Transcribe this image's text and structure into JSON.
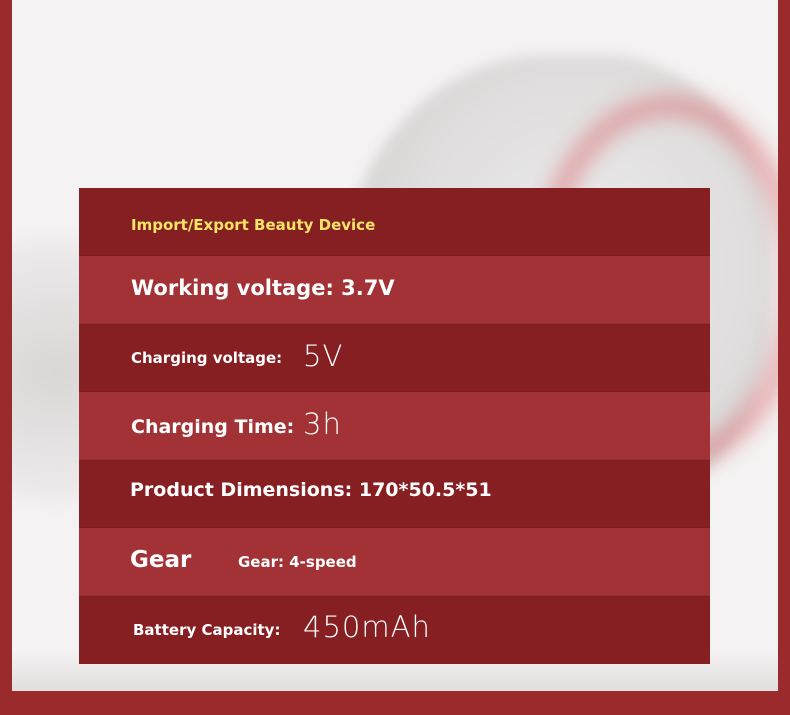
{
  "title": "Import/Export Beauty Device",
  "specs": {
    "working_voltage": "Working voltage: 3.7V",
    "charging_voltage_label": "Charging voltage:",
    "charging_voltage_value": "5V",
    "charging_time_label": "Charging Time:",
    "charging_time_value": "3h",
    "dimensions": "Product Dimensions: 170*50.5*51",
    "gear_label": "Gear",
    "gear_value": "Gear: 4-speed",
    "battery_label": "Battery Capacity:",
    "battery_value": "450mAh"
  },
  "colors": {
    "frame": "#9b2a2d",
    "row_dark": "#861f22",
    "row_light": "#a33236",
    "title_accent": "#f4e566",
    "background": "#f4f2f2"
  }
}
